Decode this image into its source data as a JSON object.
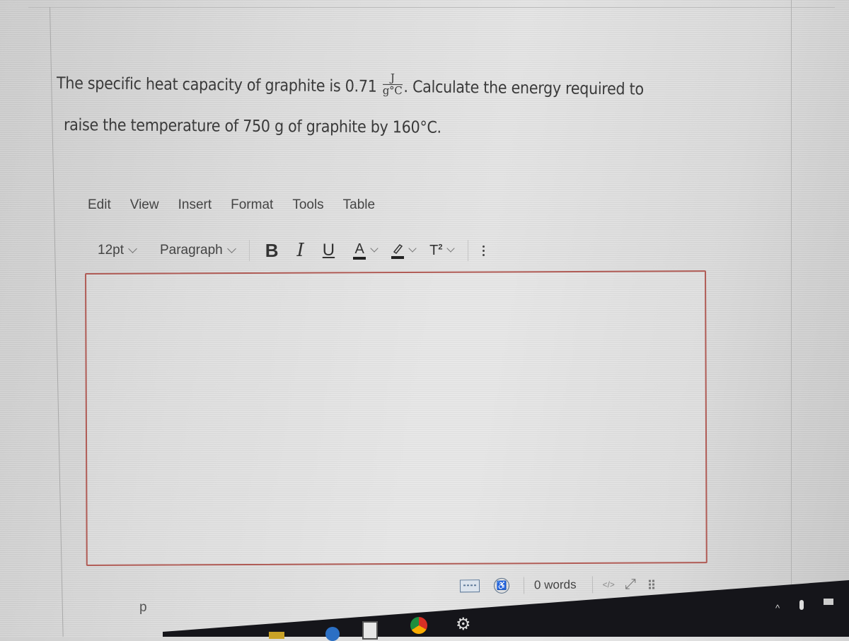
{
  "question": {
    "line1_before": "The specific heat capacity of graphite is 0.71",
    "unit_numerator": "J",
    "unit_denominator": "g°C",
    "line1_after": ". Calculate the energy required to",
    "line2": "raise the temperature of 750 g of graphite by 160°C."
  },
  "menubar": {
    "items": [
      {
        "label": "Edit"
      },
      {
        "label": "View"
      },
      {
        "label": "Insert"
      },
      {
        "label": "Format"
      },
      {
        "label": "Tools"
      },
      {
        "label": "Table"
      }
    ]
  },
  "toolbar": {
    "font_size": "12pt",
    "block_format": "Paragraph",
    "bold_label": "B",
    "italic_label": "I",
    "underline_label": "U",
    "text_color_label": "A",
    "superscript_label": "T",
    "superscript_mark": "2"
  },
  "editor": {
    "content": ""
  },
  "statusbar": {
    "word_count": "0 words",
    "code_label": "</>",
    "expand_glyph": "⤢",
    "accessibility_glyph": "♿",
    "path": "p"
  },
  "taskbar": {
    "icons": [
      "file-explorer-icon",
      "edge-icon",
      "store-icon",
      "chrome-icon",
      "settings-icon"
    ],
    "settings_glyph": "⚙"
  }
}
